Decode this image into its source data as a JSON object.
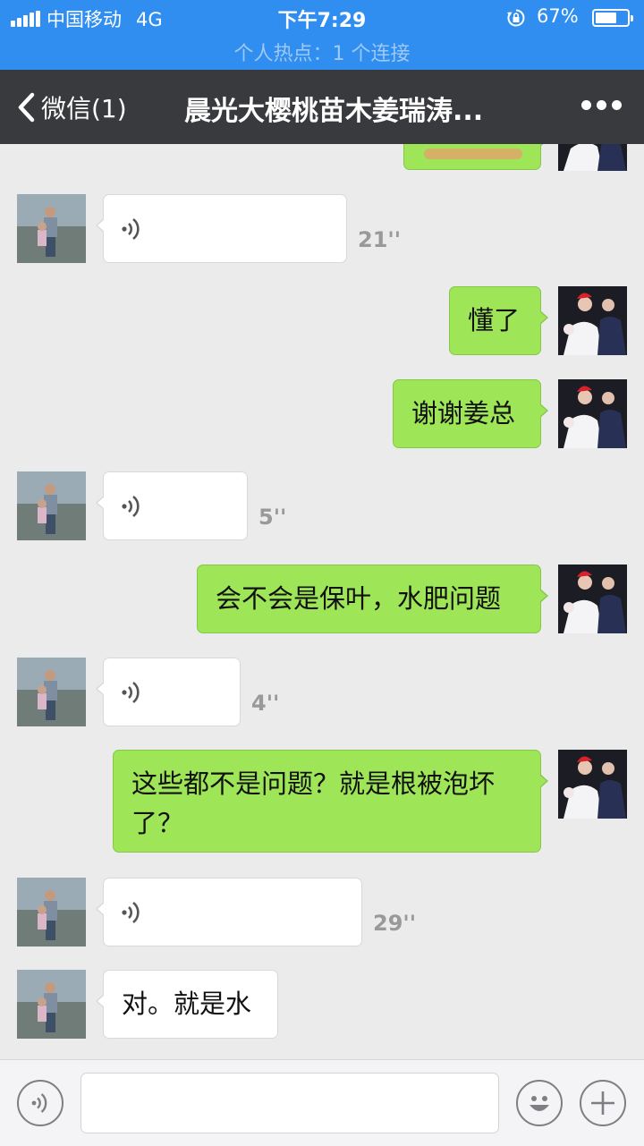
{
  "status_bar": {
    "carrier": "中国移动",
    "network": "4G",
    "time": "下午7:29",
    "battery_percent": "67%",
    "battery_level": 0.67,
    "hotspot": "个人热点：1 个连接",
    "icons": [
      "signal-icon",
      "rotation-lock-icon",
      "battery-icon"
    ]
  },
  "nav": {
    "back_label": "微信(1)",
    "title": "晨光大樱桃苗木姜瑞涛...",
    "icons": [
      "chevron-left-icon",
      "more-icon"
    ]
  },
  "messages": [
    {
      "side": "in",
      "type": "voice",
      "duration": "21''"
    },
    {
      "side": "out",
      "type": "text",
      "text": "懂了"
    },
    {
      "side": "out",
      "type": "text",
      "text": "谢谢姜总"
    },
    {
      "side": "in",
      "type": "voice",
      "duration": "5''"
    },
    {
      "side": "out",
      "type": "text",
      "text": "会不会是保叶，水肥问题"
    },
    {
      "side": "in",
      "type": "voice",
      "duration": "4''"
    },
    {
      "side": "out",
      "type": "text",
      "text_line1": "这些都不是问题？就是根被泡坏",
      "text_line2": "了？"
    },
    {
      "side": "in",
      "type": "voice",
      "duration": "29''"
    },
    {
      "side": "in",
      "type": "text",
      "text": "对。就是水"
    }
  ],
  "input_bar": {
    "icons": [
      "voice-input-icon",
      "emoji-icon",
      "plus-icon"
    ]
  },
  "colors": {
    "status_bar_bg": "#2f8ef0",
    "nav_bg": "#393a3e",
    "chat_bg": "#ebebeb",
    "outgoing_bubble": "#9ee658",
    "incoming_bubble": "#ffffff"
  }
}
